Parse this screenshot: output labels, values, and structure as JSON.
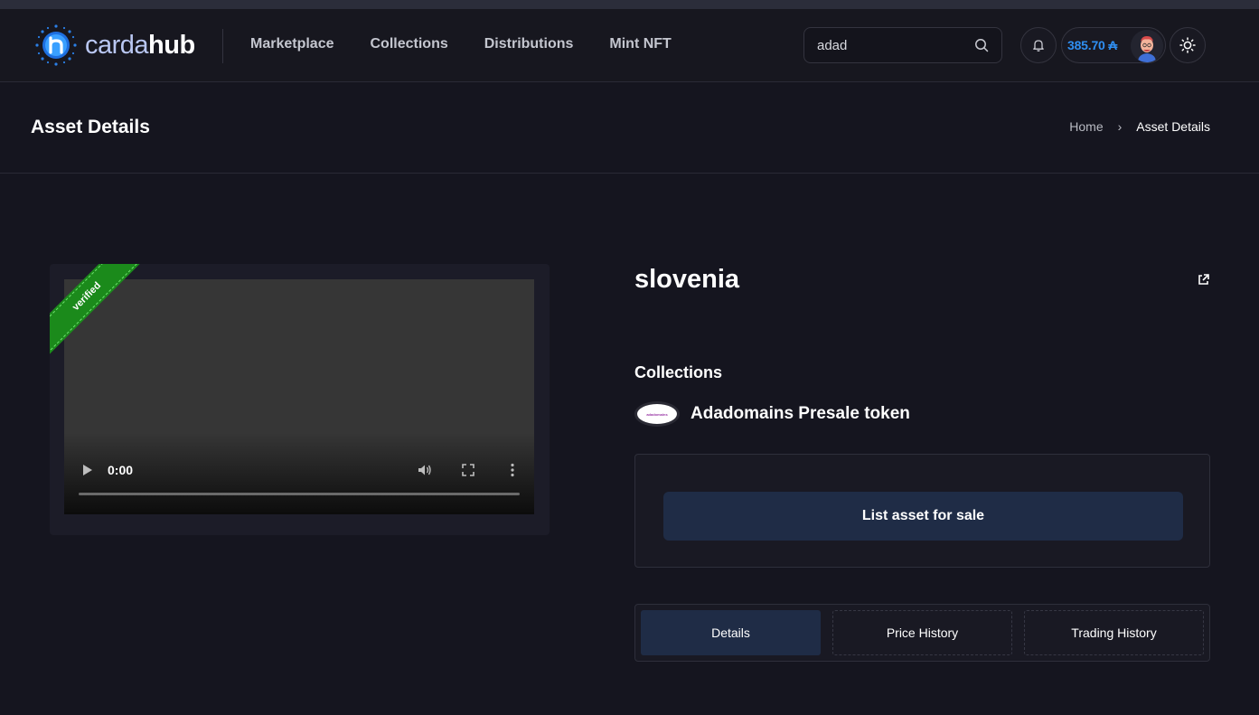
{
  "header": {
    "logo": {
      "text_light": "carda",
      "text_bold": "hub"
    },
    "nav": [
      {
        "label": "Marketplace"
      },
      {
        "label": "Collections"
      },
      {
        "label": "Distributions"
      },
      {
        "label": "Mint NFT"
      }
    ],
    "search": {
      "value": "adad"
    },
    "wallet": {
      "balance": "385.70 ₳"
    }
  },
  "page": {
    "title": "Asset Details",
    "breadcrumb": {
      "home": "Home",
      "separator": "›",
      "current": "Asset Details"
    }
  },
  "media": {
    "ribbon": "verified",
    "video": {
      "time": "0:00",
      "progress": 0
    }
  },
  "asset": {
    "name": "slovenia",
    "collections_label": "Collections",
    "collection": {
      "name": "Adadomains Presale token",
      "logo_text": "adadomains"
    },
    "list_button": "List asset for sale",
    "tabs": [
      {
        "label": "Details",
        "active": true
      },
      {
        "label": "Price History",
        "active": false
      },
      {
        "label": "Trading History",
        "active": false
      }
    ]
  },
  "colors": {
    "background": "#15151f",
    "accent_blue": "#2f8ff2",
    "button_bg": "#1f2c46",
    "ribbon_green": "#1b8a1b"
  }
}
